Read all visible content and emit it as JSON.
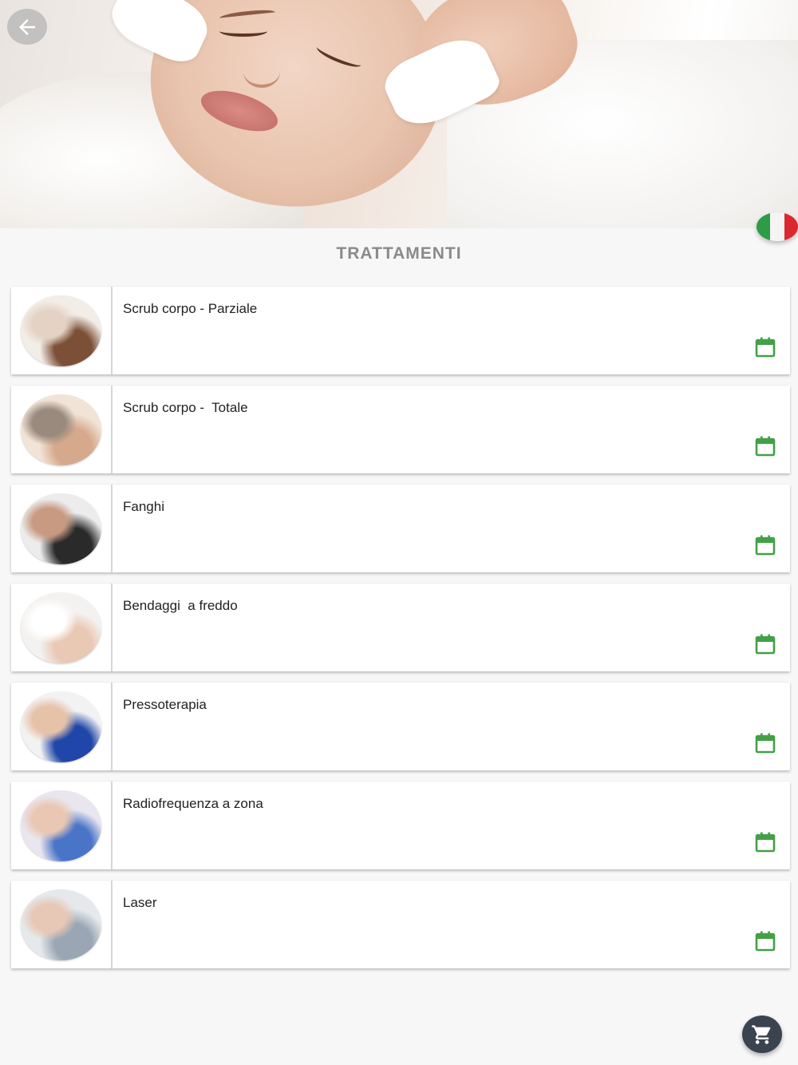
{
  "header": {
    "back_icon": "arrow-left-icon",
    "language_flag": "italy-flag-icon",
    "flag_colors": [
      "#2e9b46",
      "#f4f4f4",
      "#d9282f"
    ]
  },
  "section": {
    "title": "TRATTAMENTI"
  },
  "treatments": [
    {
      "name": "Scrub corpo - Parziale",
      "thumb_colors": [
        "#f3ede7",
        "#7b5037",
        "#e4d3c4"
      ],
      "icon": "calendar-icon"
    },
    {
      "name": "Scrub corpo -  Totale",
      "thumb_colors": [
        "#f1e3d6",
        "#d6a98c",
        "#9a8a7e"
      ],
      "icon": "calendar-icon"
    },
    {
      "name": "Fanghi",
      "thumb_colors": [
        "#ececec",
        "#2a2a2a",
        "#c89a82"
      ],
      "icon": "calendar-icon"
    },
    {
      "name": "Bendaggi  a freddo",
      "thumb_colors": [
        "#f4f2f0",
        "#e9c8b4",
        "#ffffff"
      ],
      "icon": "calendar-icon"
    },
    {
      "name": "Pressoterapia",
      "thumb_colors": [
        "#f2f2f2",
        "#1f46a8",
        "#e6c2a8"
      ],
      "icon": "calendar-icon"
    },
    {
      "name": "Radiofrequenza a zona",
      "thumb_colors": [
        "#e9e6ef",
        "#4a74c8",
        "#eac7b3"
      ],
      "icon": "calendar-icon"
    },
    {
      "name": "Laser",
      "thumb_colors": [
        "#e6e9ec",
        "#9aa6b4",
        "#e7c7b5"
      ],
      "icon": "calendar-icon"
    }
  ],
  "fab": {
    "icon": "shopping-cart-icon"
  },
  "colors": {
    "accent_green": "#43a047",
    "title_gray": "#8a8a8a",
    "fab_bg": "#3a4350"
  }
}
